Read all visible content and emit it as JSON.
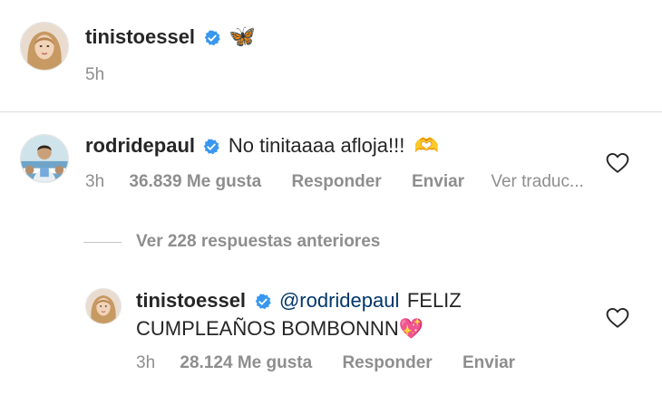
{
  "post": {
    "author": "tinistoessel",
    "caption_emoji": "🦋",
    "time": "5h"
  },
  "comment": {
    "author": "rodridepaul",
    "text": "No tinitaaaa afloja!!!",
    "emoji": "🫶",
    "time": "3h",
    "likes": "36.839 Me gusta",
    "reply": "Responder",
    "send": "Enviar",
    "translate": "Ver traduc..."
  },
  "view_replies": "Ver 228 respuestas anteriores",
  "reply": {
    "author": "tinistoessel",
    "mention": "@rodridepaul",
    "text_line1": "FELIZ",
    "text_line2": "CUMPLEAÑOS BOMBONNN",
    "emoji": "💖",
    "time": "3h",
    "likes": "28.124 Me gusta",
    "reply": "Responder",
    "send": "Enviar"
  },
  "colors": {
    "verified": "#3897f0",
    "text": "#262626",
    "secondary": "#8e8e8e",
    "mention": "#00376b"
  }
}
